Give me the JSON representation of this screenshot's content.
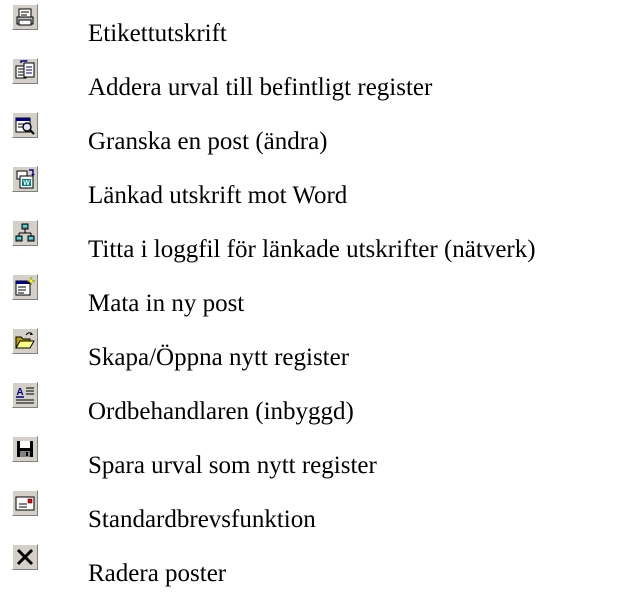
{
  "items": [
    {
      "icon": "label-print-icon",
      "label": "Etikettutskrift"
    },
    {
      "icon": "add-to-register-icon",
      "label": "Addera urval till befintligt register"
    },
    {
      "icon": "inspect-record-icon",
      "label": "Granska en post (ändra)"
    },
    {
      "icon": "word-merge-icon",
      "label": "Länkad utskrift mot Word"
    },
    {
      "icon": "network-log-icon",
      "label": "Titta i loggfil för länkade utskrifter (nätverk)"
    },
    {
      "icon": "new-record-icon",
      "label": "Mata in ny post"
    },
    {
      "icon": "open-folder-icon",
      "label": "Skapa/Öppna nytt register"
    },
    {
      "icon": "word-processor-icon",
      "label": "Ordbehandlaren (inbyggd)"
    },
    {
      "icon": "save-disk-icon",
      "label": "Spara urval som nytt register"
    },
    {
      "icon": "letter-icon",
      "label": "Standardbrevsfunktion"
    },
    {
      "icon": "delete-x-icon",
      "label": "Radera poster"
    }
  ]
}
